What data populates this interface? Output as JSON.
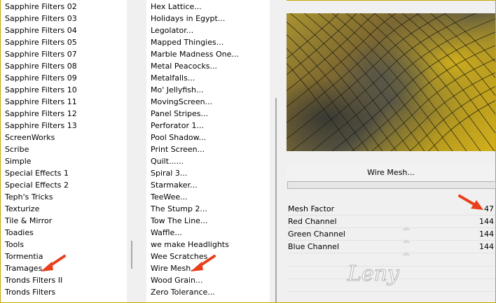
{
  "left_list": [
    "Sapphire Filters 02",
    "Sapphire Filters 03",
    "Sapphire Filters 04",
    "Sapphire Filters 05",
    "Sapphire Filters 07",
    "Sapphire Filters 08",
    "Sapphire Filters 09",
    "Sapphire Filters 10",
    "Sapphire Filters 11",
    "Sapphire Filters 12",
    "Sapphire Filters 13",
    "ScreenWorks",
    "Scribe",
    "Simple",
    "Special Effects 1",
    "Special Effects 2",
    "Teph's Tricks",
    "Texturize",
    "Tile & Mirror",
    "Toadies",
    "Tools",
    "Tormentia",
    "Tramages",
    "Tronds Filters II",
    "Tronds Filters"
  ],
  "mid_list": [
    "Hex Lattice...",
    "Holidays in Egypt...",
    "Legolator...",
    "Mapped Thingies...",
    "Marble Madness One...",
    "Metal Peacocks...",
    "Metalfalls...",
    "Mo' Jellyfish...",
    "MovingScreen...",
    "Panel Stripes...",
    "Perforator 1...",
    "Pool Shadow...",
    "Print Screen...",
    "Quilt......",
    "Spiral 3...",
    "Starmaker...",
    "TeeWee...",
    "The Stump 2...",
    "Tow The Line...",
    "Waffle...",
    "we make Headlights",
    "Wee Scratches",
    "Wire Mesh...",
    "Wood Grain...",
    "Zero Tolerance..."
  ],
  "selected_filter_label": "Wire Mesh...",
  "parameters": [
    {
      "label": "Mesh Factor",
      "value": "47"
    },
    {
      "label": "Red Channel",
      "value": "144"
    },
    {
      "label": "Green Channel",
      "value": "144"
    },
    {
      "label": "Blue Channel",
      "value": "144"
    }
  ],
  "watermark_text": "Leny",
  "icons": {
    "pointer": "red-arrow-icon"
  },
  "colors": {
    "arrow": "#e8401c",
    "frame": "#c9a400"
  }
}
